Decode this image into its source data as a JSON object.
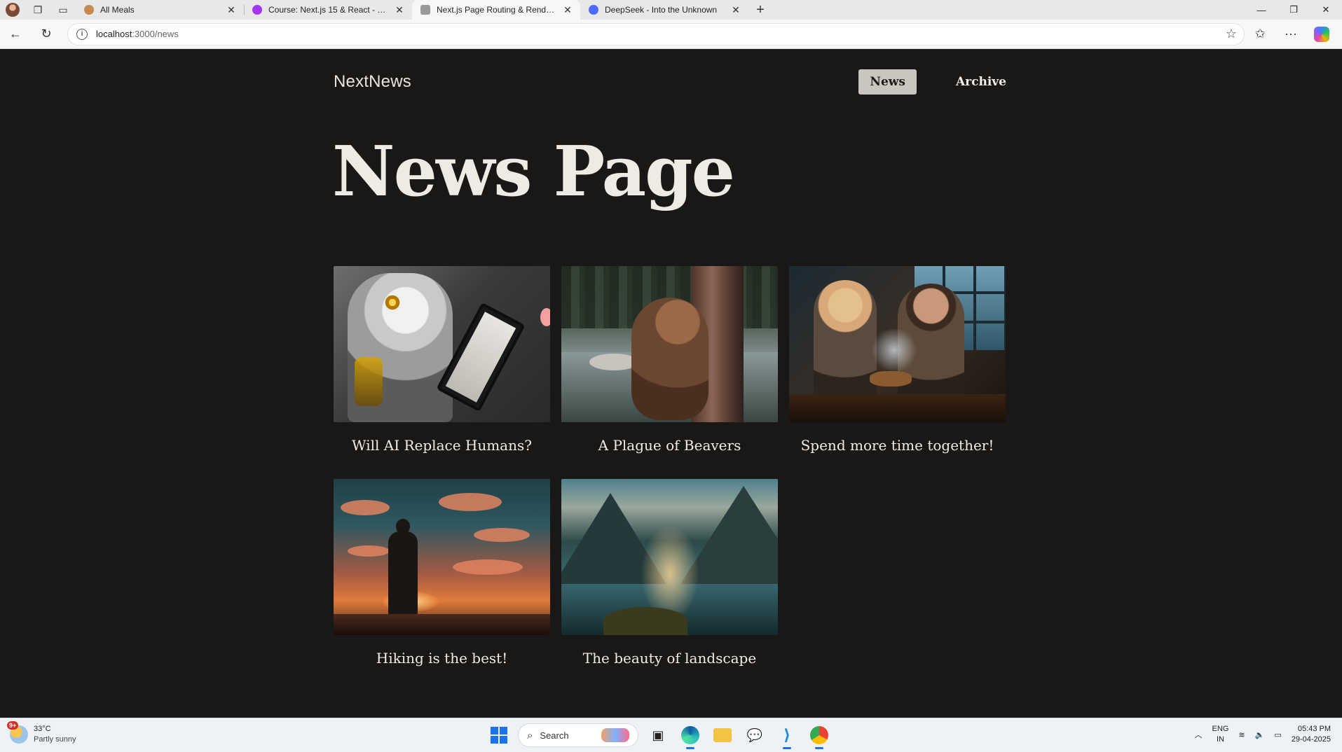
{
  "browser": {
    "tabs": [
      {
        "title": "All Meals",
        "favicon_color": "#c8894f",
        "active": false
      },
      {
        "title": "Course: Next.js 15 & React - The Complete Guide",
        "favicon_color": "#a435f0",
        "active": false
      },
      {
        "title": "Next.js Page Routing & Rendering",
        "favicon_color": "#9a9a9a",
        "active": true
      },
      {
        "title": "DeepSeek - Into the Unknown",
        "favicon_color": "#4d6bfe",
        "active": false
      }
    ],
    "url_host": "localhost",
    "url_path": ":3000/news"
  },
  "site": {
    "logo": "NextNews",
    "nav": [
      {
        "label": "News",
        "active": true
      },
      {
        "label": "Archive",
        "active": false
      }
    ]
  },
  "page": {
    "title": "News Page",
    "articles": [
      {
        "title": "Will AI Replace Humans?",
        "image": "robot-with-tablet"
      },
      {
        "title": "A Plague of Beavers",
        "image": "beaver-on-tree"
      },
      {
        "title": "Spend more time together!",
        "image": "couple-cooking"
      },
      {
        "title": "Hiking is the best!",
        "image": "hiker-at-sunset"
      },
      {
        "title": "The beauty of landscape",
        "image": "mountain-lake"
      }
    ]
  },
  "taskbar": {
    "weather_badge": "9+",
    "temperature": "33°C",
    "condition": "Partly sunny",
    "search_placeholder": "Search",
    "lang_line1": "ENG",
    "lang_line2": "IN",
    "time": "05:43 PM",
    "date": "29-04-2025"
  },
  "colors": {
    "page_background": "#1a1817",
    "nav_active_bg": "#c9c6c0",
    "text": "#efeae4"
  }
}
